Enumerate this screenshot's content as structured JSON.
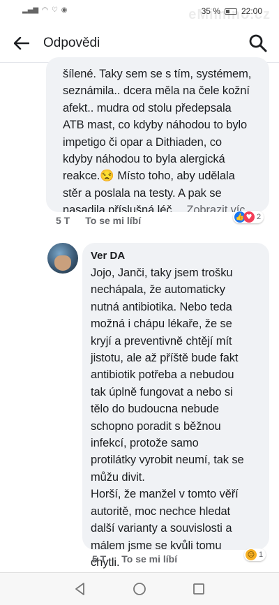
{
  "status_bar": {
    "battery": "35 %",
    "time": "22:00",
    "watermark": "eMimino.cz"
  },
  "header": {
    "title": "Odpovědi"
  },
  "comments": [
    {
      "text": "šílené. Taky sem se s tím, systémem,\nseznámila.. dcera měla na čele kožní\nafekt.. mudra od stolu předepsala\nATB mast, co kdyby náhodou to bylo\nimpetigo či opar a Dithiaden, co\nkdyby náhodou to byla alergická\nreakce.😒 Místo toho, aby udělala\nstěr a poslala na testy. A pak se\nnasadila příslušná léč…",
      "more": "Zobrazit víc",
      "time": "5 T",
      "like": "To se mi líbí",
      "reaction_count": "2"
    },
    {
      "author": "Ver DA",
      "text": "Jojo, Janči, taky jsem trošku\nnechápala, že automaticky\nnutná antibiotika. Nebo teda\nmožná i chápu lékaře, že se\nkryjí a preventivně chtějí mít\njistotu, ale až příště bude fakt\nantibiotik potřeba a nebudou\ntak úplně fungovat a nebo si\ntělo do budoucna nebude\nschopno poradit s běžnou\ninfekcí, protože samo\nprotilátky vyrobit neumí, tak se\nmůžu divit.\nHorší, že manžel v tomto věří\nautoritě, moc nechce hledat\ndalší varianty a souvislosti a\nmálem jsme se kvůli tomu\nchytli.",
      "time": "5 T",
      "like": "To se mi líbí",
      "reaction_count": "1"
    }
  ],
  "colors": {
    "bubble": "#f0f2f5",
    "like_blue": "#1877f2",
    "love_red": "#f33e58",
    "sad_yellow": "#f7b125"
  },
  "icons": [
    "back-arrow-icon",
    "search-icon",
    "like-reaction-icon",
    "love-reaction-icon",
    "sad-reaction-icon",
    "nav-back-icon",
    "nav-home-icon",
    "nav-recents-icon"
  ]
}
